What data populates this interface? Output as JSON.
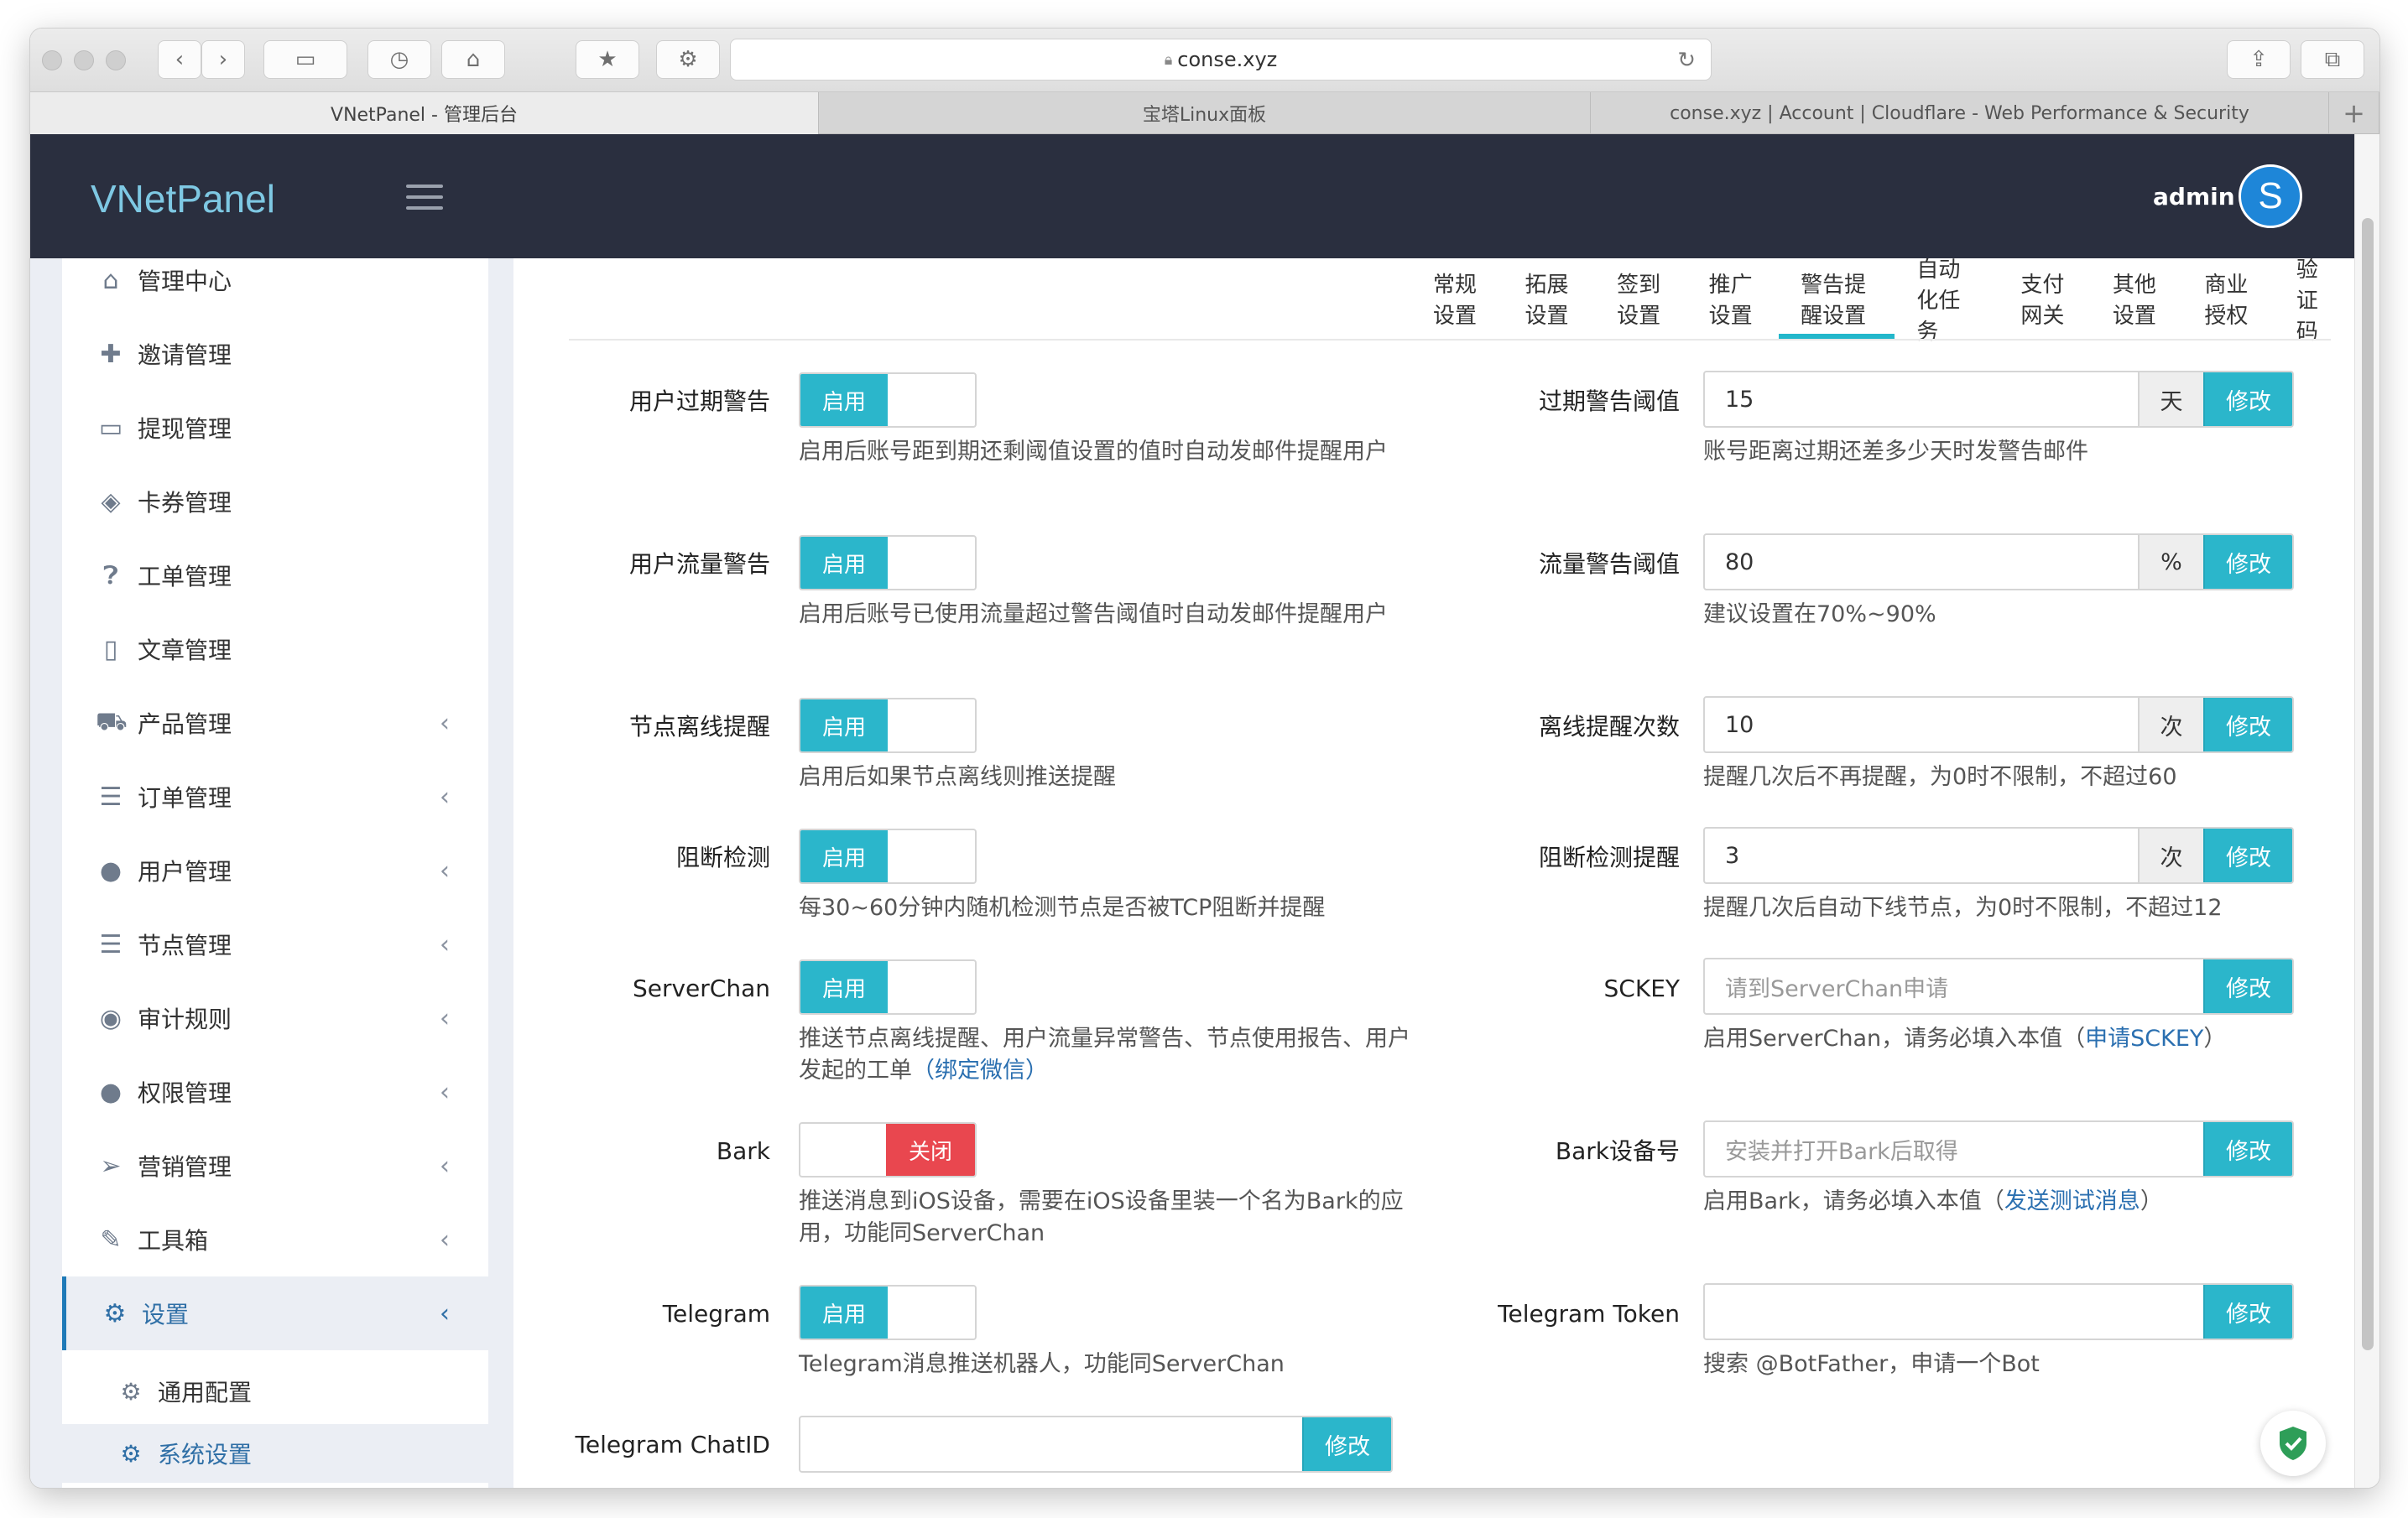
{
  "browser": {
    "url": "conse.xyz",
    "tabs": [
      {
        "label": "VNetPanel - 管理后台"
      },
      {
        "label": "宝塔Linux面板"
      },
      {
        "label": "conse.xyz | Account | Cloudflare - Web Performance & Security"
      }
    ],
    "new_tab": "+"
  },
  "header": {
    "brand": "VNetPanel",
    "user": "admin",
    "avatar_letter": "S"
  },
  "sidebar": {
    "items": [
      {
        "label": "管理中心",
        "icon": "home-icon"
      },
      {
        "label": "邀请管理",
        "icon": "puzzle-icon"
      },
      {
        "label": "提现管理",
        "icon": "credit-card-icon"
      },
      {
        "label": "卡券管理",
        "icon": "ticket-icon"
      },
      {
        "label": "工单管理",
        "icon": "question-icon"
      },
      {
        "label": "文章管理",
        "icon": "document-icon"
      },
      {
        "label": "产品管理",
        "icon": "cart-icon"
      },
      {
        "label": "订单管理",
        "icon": "list-icon"
      },
      {
        "label": "用户管理",
        "icon": "users-icon"
      },
      {
        "label": "节点管理",
        "icon": "server-list-icon"
      },
      {
        "label": "审计规则",
        "icon": "eye-icon"
      },
      {
        "label": "权限管理",
        "icon": "users-icon"
      },
      {
        "label": "营销管理",
        "icon": "paper-plane-icon"
      },
      {
        "label": "工具箱",
        "icon": "wrench-icon"
      },
      {
        "label": "设置",
        "icon": "gear-icon"
      }
    ],
    "sub_items": [
      {
        "label": "通用配置",
        "icon": "gear-icon"
      },
      {
        "label": "系统设置",
        "icon": "gears-icon"
      }
    ]
  },
  "tabs": [
    "常规设置",
    "拓展设置",
    "签到设置",
    "推广设置",
    "警告提醒设置",
    "自动化任务",
    "支付网关",
    "其他设置",
    "商业授权",
    "验证码"
  ],
  "active_tab": "警告提醒设置",
  "settings_left": [
    {
      "label": "用户过期警告",
      "state": "启用",
      "help": "启用后账号距到期还剩阈值设置的值时自动发邮件提醒用户"
    },
    {
      "label": "用户流量警告",
      "state": "启用",
      "help": "启用后账号已使用流量超过警告阈值时自动发邮件提醒用户"
    },
    {
      "label": "节点离线提醒",
      "state": "启用",
      "help": "启用后如果节点离线则推送提醒"
    },
    {
      "label": "阻断检测",
      "state": "启用",
      "help": "每30~60分钟内随机检测节点是否被TCP阻断并提醒"
    },
    {
      "label": "ServerChan",
      "state": "启用",
      "help": "推送节点离线提醒、用户流量异常警告、节点使用报告、用户发起的工单",
      "help_link": "（绑定微信）"
    },
    {
      "label": "Bark",
      "state": "关闭",
      "help": "推送消息到iOS设备，需要在iOS设备里装一个名为Bark的应用，功能同ServerChan"
    },
    {
      "label": "Telegram",
      "state": "启用",
      "help": "Telegram消息推送机器人，功能同ServerChan"
    },
    {
      "label": "Telegram ChatID",
      "value": "",
      "button": "修改"
    }
  ],
  "settings_right": [
    {
      "label": "过期警告阈值",
      "value": "15",
      "unit": "天",
      "button": "修改",
      "help": "账号距离过期还差多少天时发警告邮件"
    },
    {
      "label": "流量警告阈值",
      "value": "80",
      "unit": "%",
      "button": "修改",
      "help": "建议设置在70%~90%"
    },
    {
      "label": "离线提醒次数",
      "value": "10",
      "unit": "次",
      "button": "修改",
      "help": "提醒几次后不再提醒，为0时不限制，不超过60"
    },
    {
      "label": "阻断检测提醒",
      "value": "3",
      "unit": "次",
      "button": "修改",
      "help": "提醒几次后自动下线节点，为0时不限制，不超过12"
    },
    {
      "label": "SCKEY",
      "placeholder": "请到ServerChan申请",
      "button": "修改",
      "help": "启用ServerChan，请务必填入本值（",
      "help_link": "申请SCKEY",
      "help_tail": "）"
    },
    {
      "label": "Bark设备号",
      "placeholder": "安装并打开Bark后取得",
      "button": "修改",
      "help": "启用Bark，请务必填入本值（",
      "help_link": "发送测试消息",
      "help_tail": "）"
    },
    {
      "label": "Telegram Token",
      "value": "",
      "button": "修改",
      "help": "搜索 @BotFather，申请一个Bot"
    }
  ],
  "colors": {
    "accent": "#2bb6cb",
    "danger": "#e9474f",
    "header": "#2a2f3f",
    "link": "#2a6fb0"
  }
}
